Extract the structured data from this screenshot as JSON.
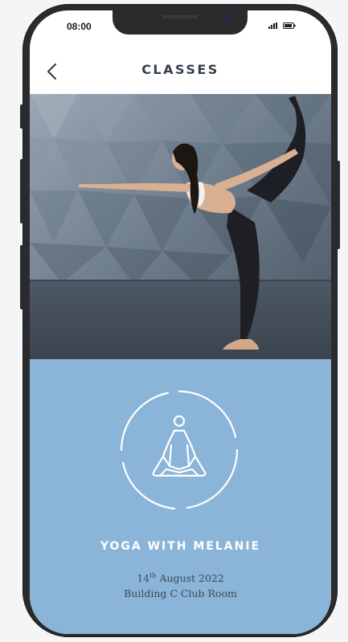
{
  "status_bar": {
    "time": "08:00",
    "icons": [
      "signal-icon",
      "battery-icon"
    ]
  },
  "header": {
    "title": "CLASSES",
    "back_icon": "chevron-left-icon"
  },
  "hero": {
    "image": "woman-yoga-dancer-pose-photo"
  },
  "class_info": {
    "icon": "meditation-icon",
    "title": "YOGA WITH MELANIE",
    "day": "14",
    "day_suffix": "th",
    "month_year": "August 2022",
    "location": "Building C Club Room"
  },
  "colors": {
    "accent_blue": "#8ab5d8",
    "title_text": "#36404c",
    "frame": "#2b2b2d"
  }
}
